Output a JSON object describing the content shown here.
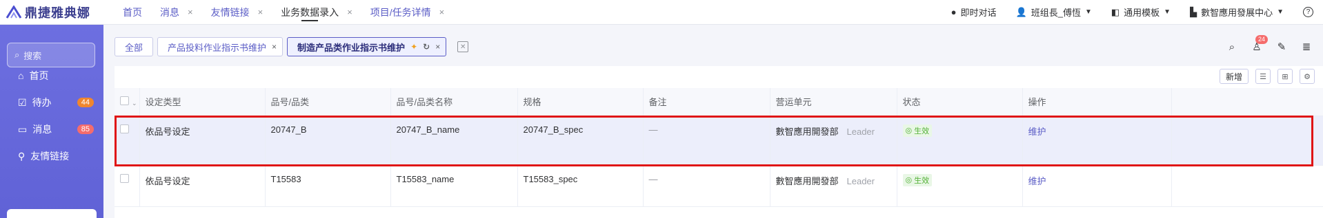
{
  "app": {
    "logo_text": "鼎捷雅典娜"
  },
  "nav": {
    "items": [
      {
        "label": "首页",
        "closable": false
      },
      {
        "label": "消息",
        "closable": true
      },
      {
        "label": "友情链接",
        "closable": true
      },
      {
        "label": "业务数据录入",
        "closable": true,
        "active": true
      },
      {
        "label": "项目/任务详情",
        "closable": true
      }
    ],
    "close_glyph": "×"
  },
  "topright": {
    "chat": "即时对话",
    "user": "班组長_傅恆",
    "template": "通用模板",
    "org": "數智應用發展中心",
    "help": "?"
  },
  "sidebar": {
    "search_placeholder": "搜索",
    "items": [
      {
        "label": "首页",
        "icon": "home-icon"
      },
      {
        "label": "待办",
        "icon": "todo-icon",
        "badge": "44"
      },
      {
        "label": "消息",
        "icon": "message-icon",
        "badge": "85"
      },
      {
        "label": "友情链接",
        "icon": "link-icon"
      }
    ]
  },
  "tabs": {
    "all": "全部",
    "tab1": "产品投料作业指示书维护",
    "tab2": "制造产品类作业指示书维护"
  },
  "notification_count": "24",
  "toolbar": {
    "new_label": "新增"
  },
  "table": {
    "headers": [
      "设定类型",
      "品号/品类",
      "品号/品类名称",
      "规格",
      "备注",
      "营运单元",
      "状态",
      "操作"
    ],
    "rows": [
      {
        "type": "依品号设定",
        "code": "20747_B",
        "name": "20747_B_name",
        "spec": "20747_B_spec",
        "note": "—",
        "unit": "數智應用開發部",
        "role": "Leader",
        "status": "生效",
        "action": "维护"
      },
      {
        "type": "依品号设定",
        "code": "T15583",
        "name": "T15583_name",
        "spec": "T15583_spec",
        "note": "—",
        "unit": "數智應用開發部",
        "role": "Leader",
        "status": "生效",
        "action": "维护"
      }
    ]
  },
  "colors": {
    "accent": "#5a5cc6",
    "sidebar": "#6d6fe0",
    "highlight": "#e01515",
    "status_green": "#52b035"
  }
}
